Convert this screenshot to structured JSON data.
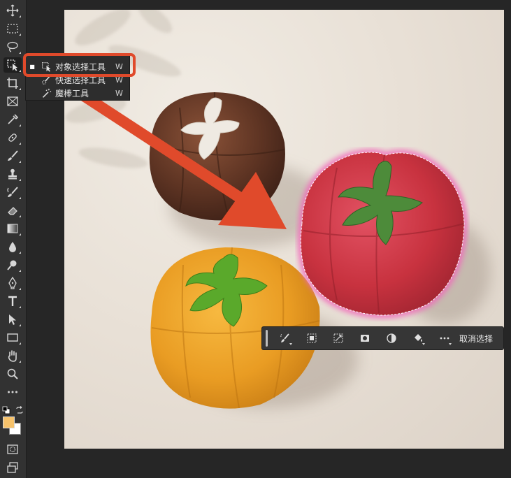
{
  "flyout": {
    "items": [
      {
        "label": "对象选择工具",
        "shortcut": "W",
        "active": true
      },
      {
        "label": "快速选择工具",
        "shortcut": "W",
        "active": false
      },
      {
        "label": "魔棒工具",
        "shortcut": "W",
        "active": false
      }
    ]
  },
  "taskbar": {
    "deselect_label": "取消选择"
  },
  "colors": {
    "foreground": "#f6c26b",
    "background": "#ffffff",
    "highlight": "#e04a2b"
  },
  "toolbar_icons": [
    "move-icon",
    "marquee-icon",
    "lasso-icon",
    "object-selection-icon",
    "crop-icon",
    "frame-icon",
    "eyedropper-icon",
    "healing-brush-icon",
    "brush-icon",
    "stamp-icon",
    "history-brush-icon",
    "eraser-icon",
    "gradient-icon",
    "blur-icon",
    "dodge-icon",
    "pen-icon",
    "type-icon",
    "path-selection-icon",
    "rectangle-icon",
    "hand-icon",
    "zoom-icon",
    "more-icon"
  ]
}
